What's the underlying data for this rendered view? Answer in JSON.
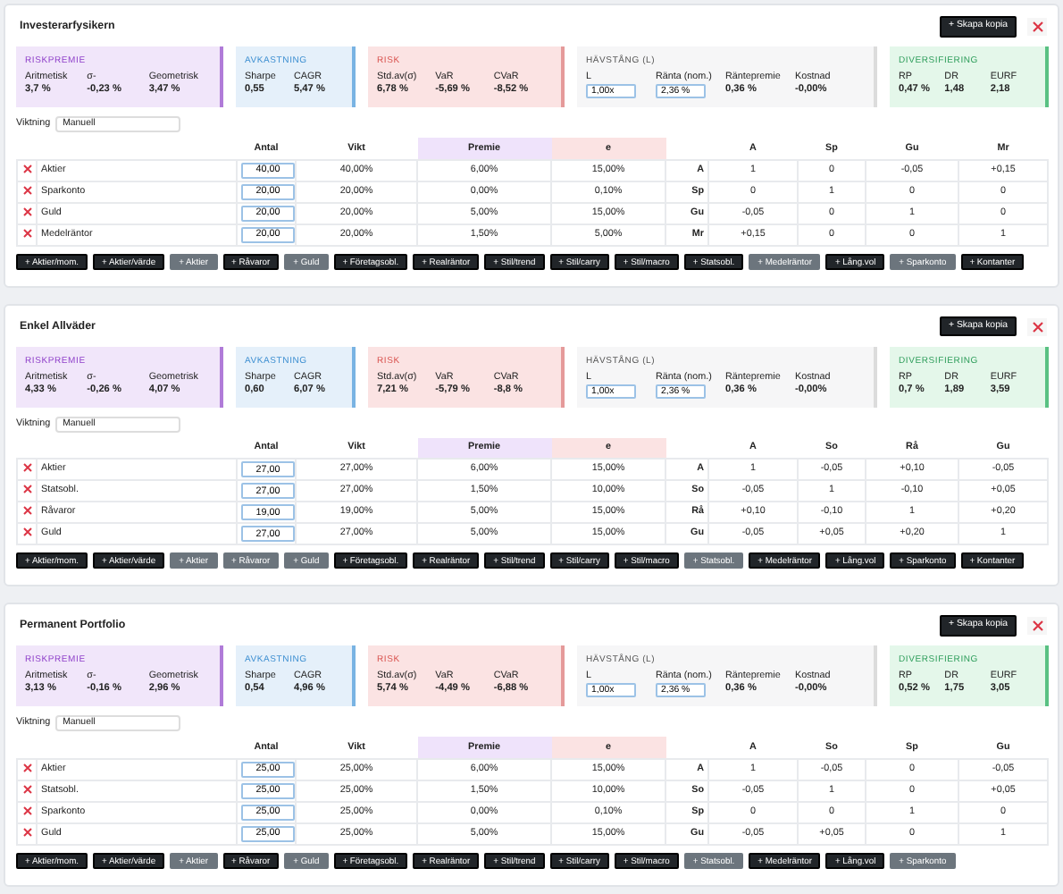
{
  "portfolios": [
    {
      "title": "Investerarfysikern",
      "copy_button": "+ Skapa kopia",
      "panels": [
        {
          "kind": "riskpremie",
          "title": "RISKPREMIE",
          "items": [
            {
              "label": "Aritmetisk",
              "value": "3,7 %"
            },
            {
              "label": "σ-",
              "value": "-0,23 %"
            },
            {
              "label": "Geometrisk",
              "value": "3,47 %"
            }
          ]
        },
        {
          "kind": "avkastning",
          "title": "AVKASTNING",
          "items": [
            {
              "label": "Sharpe",
              "value": "0,55"
            },
            {
              "label": "CAGR",
              "value": "5,47 %"
            }
          ]
        },
        {
          "kind": "risk",
          "title": "RISK",
          "items": [
            {
              "label": "Std.av(σ)",
              "value": "6,78 %"
            },
            {
              "label": "VaR",
              "value": "-5,69 %"
            },
            {
              "label": "CVaR",
              "value": "-8,52 %"
            }
          ]
        },
        {
          "kind": "havstang",
          "title": "HÄVSTÅNG (L)",
          "items": [
            {
              "label": "L",
              "value": "1,00x",
              "editable": true
            },
            {
              "label": "Ränta (nom.)",
              "value": "2,36 %",
              "editable": true
            },
            {
              "label": "Räntepremie",
              "value": "0,36 %",
              "editable": false
            },
            {
              "label": "Kostnad",
              "value": "-0,00%",
              "editable": false
            }
          ]
        },
        {
          "kind": "diversifiering",
          "title": "DIVERSIFIERING",
          "items": [
            {
              "label": "RP",
              "value": "0,47 %"
            },
            {
              "label": "DR",
              "value": "1,48"
            },
            {
              "label": "EURF",
              "value": "2,18"
            }
          ]
        }
      ],
      "weighting": {
        "label": "Viktning",
        "value": "Manuell"
      },
      "columns": [
        "Antal",
        "Vikt",
        "Premie",
        "e"
      ],
      "matrix_columns": [
        "A",
        "Sp",
        "Gu",
        "Mr"
      ],
      "rows": [
        {
          "name": "Aktier",
          "antal": "40,00",
          "vikt": "40,00%",
          "premie": "6,00%",
          "e": "15,00%",
          "code": "A",
          "corr": [
            "1",
            "0",
            "-0,05",
            "+0,15"
          ]
        },
        {
          "name": "Sparkonto",
          "antal": "20,00",
          "vikt": "20,00%",
          "premie": "0,00%",
          "e": "0,10%",
          "code": "Sp",
          "corr": [
            "0",
            "1",
            "0",
            "0"
          ]
        },
        {
          "name": "Guld",
          "antal": "20,00",
          "vikt": "20,00%",
          "premie": "5,00%",
          "e": "15,00%",
          "code": "Gu",
          "corr": [
            "-0,05",
            "0",
            "1",
            "0"
          ]
        },
        {
          "name": "Medelräntor",
          "antal": "20,00",
          "vikt": "20,00%",
          "premie": "1,50%",
          "e": "5,00%",
          "code": "Mr",
          "corr": [
            "+0,15",
            "0",
            "0",
            "1"
          ]
        }
      ],
      "add_buttons": [
        {
          "label": "+ Aktier/mom.",
          "disabled": false
        },
        {
          "label": "+ Aktier/värde",
          "disabled": false
        },
        {
          "label": "+ Aktier",
          "disabled": true
        },
        {
          "label": "+ Råvaror",
          "disabled": false
        },
        {
          "label": "+ Guld",
          "disabled": true
        },
        {
          "label": "+ Företagsobl.",
          "disabled": false
        },
        {
          "label": "+ Realräntor",
          "disabled": false
        },
        {
          "label": "+ Stil/trend",
          "disabled": false
        },
        {
          "label": "+ Stil/carry",
          "disabled": false
        },
        {
          "label": "+ Stil/macro",
          "disabled": false
        },
        {
          "label": "+ Statsobl.",
          "disabled": false
        },
        {
          "label": "+ Medelräntor",
          "disabled": true
        },
        {
          "label": "+ Lång.vol",
          "disabled": false
        },
        {
          "label": "+ Sparkonto",
          "disabled": true
        },
        {
          "label": "+ Kontanter",
          "disabled": false
        }
      ]
    },
    {
      "title": "Enkel Allväder",
      "copy_button": "+ Skapa kopia",
      "panels": [
        {
          "kind": "riskpremie",
          "title": "RISKPREMIE",
          "items": [
            {
              "label": "Aritmetisk",
              "value": "4,33 %"
            },
            {
              "label": "σ-",
              "value": "-0,26 %"
            },
            {
              "label": "Geometrisk",
              "value": "4,07 %"
            }
          ]
        },
        {
          "kind": "avkastning",
          "title": "AVKASTNING",
          "items": [
            {
              "label": "Sharpe",
              "value": "0,60"
            },
            {
              "label": "CAGR",
              "value": "6,07 %"
            }
          ]
        },
        {
          "kind": "risk",
          "title": "RISK",
          "items": [
            {
              "label": "Std.av(σ)",
              "value": "7,21 %"
            },
            {
              "label": "VaR",
              "value": "-5,79 %"
            },
            {
              "label": "CVaR",
              "value": "-8,8 %"
            }
          ]
        },
        {
          "kind": "havstang",
          "title": "HÄVSTÅNG (L)",
          "items": [
            {
              "label": "L",
              "value": "1,00x",
              "editable": true
            },
            {
              "label": "Ränta (nom.)",
              "value": "2,36 %",
              "editable": true
            },
            {
              "label": "Räntepremie",
              "value": "0,36 %",
              "editable": false
            },
            {
              "label": "Kostnad",
              "value": "-0,00%",
              "editable": false
            }
          ]
        },
        {
          "kind": "diversifiering",
          "title": "DIVERSIFIERING",
          "items": [
            {
              "label": "RP",
              "value": "0,7 %"
            },
            {
              "label": "DR",
              "value": "1,89"
            },
            {
              "label": "EURF",
              "value": "3,59"
            }
          ]
        }
      ],
      "weighting": {
        "label": "Viktning",
        "value": "Manuell"
      },
      "columns": [
        "Antal",
        "Vikt",
        "Premie",
        "e"
      ],
      "matrix_columns": [
        "A",
        "So",
        "Rå",
        "Gu"
      ],
      "rows": [
        {
          "name": "Aktier",
          "antal": "27,00",
          "vikt": "27,00%",
          "premie": "6,00%",
          "e": "15,00%",
          "code": "A",
          "corr": [
            "1",
            "-0,05",
            "+0,10",
            "-0,05"
          ]
        },
        {
          "name": "Statsobl.",
          "antal": "27,00",
          "vikt": "27,00%",
          "premie": "1,50%",
          "e": "10,00%",
          "code": "So",
          "corr": [
            "-0,05",
            "1",
            "-0,10",
            "+0,05"
          ]
        },
        {
          "name": "Råvaror",
          "antal": "19,00",
          "vikt": "19,00%",
          "premie": "5,00%",
          "e": "15,00%",
          "code": "Rå",
          "corr": [
            "+0,10",
            "-0,10",
            "1",
            "+0,20"
          ]
        },
        {
          "name": "Guld",
          "antal": "27,00",
          "vikt": "27,00%",
          "premie": "5,00%",
          "e": "15,00%",
          "code": "Gu",
          "corr": [
            "-0,05",
            "+0,05",
            "+0,20",
            "1"
          ]
        }
      ],
      "add_buttons": [
        {
          "label": "+ Aktier/mom.",
          "disabled": false
        },
        {
          "label": "+ Aktier/värde",
          "disabled": false
        },
        {
          "label": "+ Aktier",
          "disabled": true
        },
        {
          "label": "+ Råvaror",
          "disabled": true
        },
        {
          "label": "+ Guld",
          "disabled": true
        },
        {
          "label": "+ Företagsobl.",
          "disabled": false
        },
        {
          "label": "+ Realräntor",
          "disabled": false
        },
        {
          "label": "+ Stil/trend",
          "disabled": false
        },
        {
          "label": "+ Stil/carry",
          "disabled": false
        },
        {
          "label": "+ Stil/macro",
          "disabled": false
        },
        {
          "label": "+ Statsobl.",
          "disabled": true
        },
        {
          "label": "+ Medelräntor",
          "disabled": false
        },
        {
          "label": "+ Lång.vol",
          "disabled": false
        },
        {
          "label": "+ Sparkonto",
          "disabled": false
        },
        {
          "label": "+ Kontanter",
          "disabled": false
        }
      ]
    },
    {
      "title": "Permanent Portfolio",
      "copy_button": "+ Skapa kopia",
      "panels": [
        {
          "kind": "riskpremie",
          "title": "RISKPREMIE",
          "items": [
            {
              "label": "Aritmetisk",
              "value": "3,13 %"
            },
            {
              "label": "σ-",
              "value": "-0,16 %"
            },
            {
              "label": "Geometrisk",
              "value": "2,96 %"
            }
          ]
        },
        {
          "kind": "avkastning",
          "title": "AVKASTNING",
          "items": [
            {
              "label": "Sharpe",
              "value": "0,54"
            },
            {
              "label": "CAGR",
              "value": "4,96 %"
            }
          ]
        },
        {
          "kind": "risk",
          "title": "RISK",
          "items": [
            {
              "label": "Std.av(σ)",
              "value": "5,74 %"
            },
            {
              "label": "VaR",
              "value": "-4,49 %"
            },
            {
              "label": "CVaR",
              "value": "-6,88 %"
            }
          ]
        },
        {
          "kind": "havstang",
          "title": "HÄVSTÅNG (L)",
          "items": [
            {
              "label": "L",
              "value": "1,00x",
              "editable": true
            },
            {
              "label": "Ränta (nom.)",
              "value": "2,36 %",
              "editable": true
            },
            {
              "label": "Räntepremie",
              "value": "0,36 %",
              "editable": false
            },
            {
              "label": "Kostnad",
              "value": "-0,00%",
              "editable": false
            }
          ]
        },
        {
          "kind": "diversifiering",
          "title": "DIVERSIFIERING",
          "items": [
            {
              "label": "RP",
              "value": "0,52 %"
            },
            {
              "label": "DR",
              "value": "1,75"
            },
            {
              "label": "EURF",
              "value": "3,05"
            }
          ]
        }
      ],
      "weighting": {
        "label": "Viktning",
        "value": "Manuell"
      },
      "columns": [
        "Antal",
        "Vikt",
        "Premie",
        "e"
      ],
      "matrix_columns": [
        "A",
        "So",
        "Sp",
        "Gu"
      ],
      "rows": [
        {
          "name": "Aktier",
          "antal": "25,00",
          "vikt": "25,00%",
          "premie": "6,00%",
          "e": "15,00%",
          "code": "A",
          "corr": [
            "1",
            "-0,05",
            "0",
            "-0,05"
          ]
        },
        {
          "name": "Statsobl.",
          "antal": "25,00",
          "vikt": "25,00%",
          "premie": "1,50%",
          "e": "10,00%",
          "code": "So",
          "corr": [
            "-0,05",
            "1",
            "0",
            "+0,05"
          ]
        },
        {
          "name": "Sparkonto",
          "antal": "25,00",
          "vikt": "25,00%",
          "premie": "0,00%",
          "e": "0,10%",
          "code": "Sp",
          "corr": [
            "0",
            "0",
            "1",
            "0"
          ]
        },
        {
          "name": "Guld",
          "antal": "25,00",
          "vikt": "25,00%",
          "premie": "5,00%",
          "e": "15,00%",
          "code": "Gu",
          "corr": [
            "-0,05",
            "+0,05",
            "0",
            "1"
          ]
        }
      ],
      "add_buttons": [
        {
          "label": "+ Aktier/mom.",
          "disabled": false
        },
        {
          "label": "+ Aktier/värde",
          "disabled": false
        },
        {
          "label": "+ Aktier",
          "disabled": true
        },
        {
          "label": "+ Råvaror",
          "disabled": false
        },
        {
          "label": "+ Guld",
          "disabled": true
        },
        {
          "label": "+ Företagsobl.",
          "disabled": false
        },
        {
          "label": "+ Realräntor",
          "disabled": false
        },
        {
          "label": "+ Stil/trend",
          "disabled": false
        },
        {
          "label": "+ Stil/carry",
          "disabled": false
        },
        {
          "label": "+ Stil/macro",
          "disabled": false
        },
        {
          "label": "+ Statsobl.",
          "disabled": true
        },
        {
          "label": "+ Medelräntor",
          "disabled": false
        },
        {
          "label": "+ Lång.vol",
          "disabled": false
        },
        {
          "label": "+ Sparkonto",
          "disabled": true
        }
      ]
    }
  ]
}
